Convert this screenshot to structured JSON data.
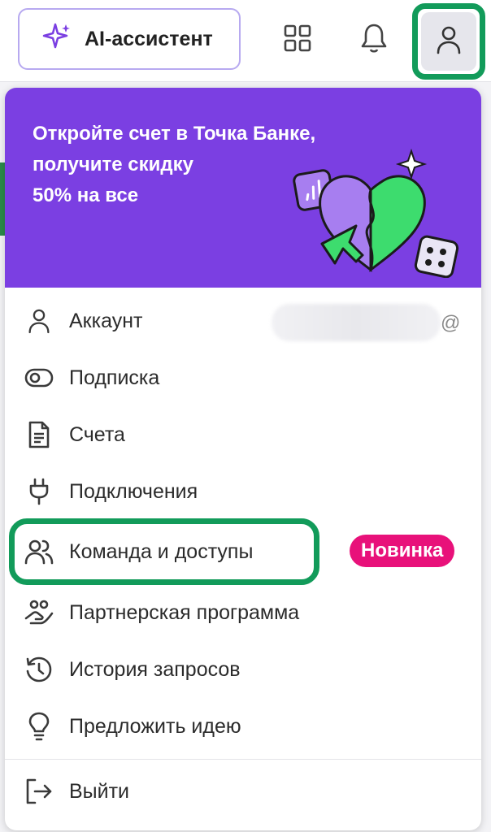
{
  "header": {
    "ai_button_label": "AI-ассистент",
    "icons": [
      "sparkle-icon",
      "apps-grid-icon",
      "bell-icon",
      "user-icon"
    ]
  },
  "promo": {
    "line1": "Откройте счет в Точка Банке,",
    "line2": "получите скидку",
    "line3": "50% на все",
    "background_color": "#7b3fe2",
    "accent_color": "#3ddc6e"
  },
  "menu": {
    "account_label": "Аккаунт",
    "account_suffix": "@",
    "items": [
      {
        "label": "Подписка",
        "icon": "subscription-toggle-icon"
      },
      {
        "label": "Счета",
        "icon": "document-icon"
      },
      {
        "label": "Подключения",
        "icon": "plug-icon"
      },
      {
        "label": "Команда и доступы",
        "icon": "team-icon"
      },
      {
        "label": "Партнерская программа",
        "icon": "partner-handshake-icon"
      },
      {
        "label": "История запросов",
        "icon": "history-icon"
      },
      {
        "label": "Предложить идею",
        "icon": "lightbulb-icon"
      }
    ],
    "new_badge": "Новинка",
    "logout_label": "Выйти"
  },
  "colors": {
    "highlight": "#129b5a",
    "badge": "#e8117a"
  }
}
